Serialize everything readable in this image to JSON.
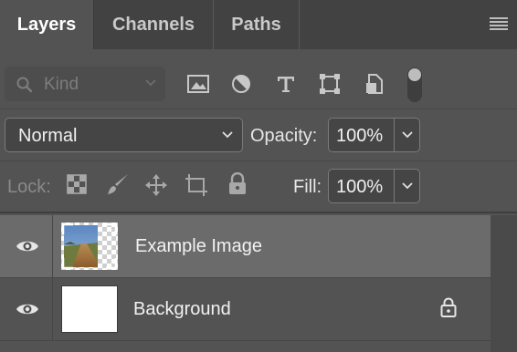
{
  "tabs": [
    {
      "label": "Layers",
      "active": true
    },
    {
      "label": "Channels",
      "active": false
    },
    {
      "label": "Paths",
      "active": false
    }
  ],
  "filter": {
    "kind_label": "Kind",
    "icons": [
      "image-filter-icon",
      "adjustment-filter-icon",
      "type-filter-icon",
      "shape-filter-icon",
      "smart-object-filter-icon",
      "filter-toggle-icon"
    ]
  },
  "blend": {
    "mode": "Normal"
  },
  "opacity": {
    "label": "Opacity:",
    "value": "100%"
  },
  "lock": {
    "label": "Lock:",
    "icons": [
      "lock-transparent-icon",
      "lock-image-icon",
      "lock-position-icon",
      "lock-artboard-icon",
      "lock-all-icon"
    ]
  },
  "fill": {
    "label": "Fill:",
    "value": "100%"
  },
  "layers": [
    {
      "name": "Example Image",
      "visible": true,
      "selected": true,
      "locked": false
    },
    {
      "name": "Background",
      "visible": true,
      "selected": false,
      "locked": true
    }
  ],
  "colors": {
    "panel": "#535353",
    "tabbar": "#424242",
    "selected_row": "#6b6b6b"
  }
}
